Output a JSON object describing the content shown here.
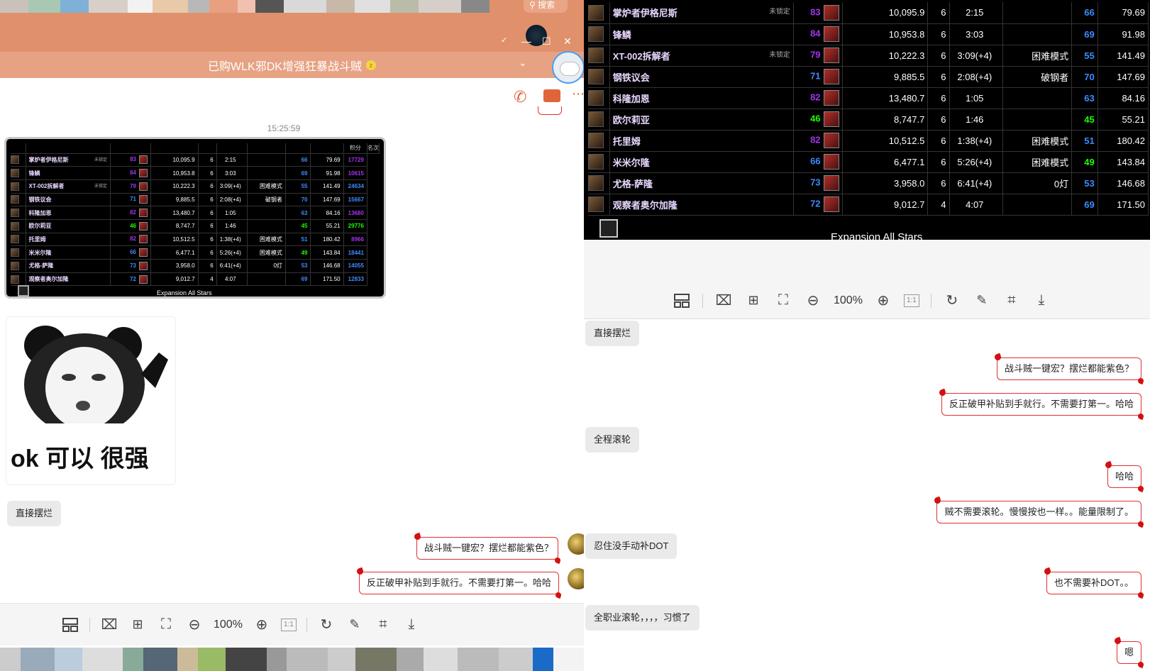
{
  "chat": {
    "title": "已购WLK邪DK增强狂暴战斗贼",
    "timestamp": "15:25:59",
    "search_placeholder": "搜索"
  },
  "scoreboard": {
    "header_small": [
      "",
      "",
      "",
      "",
      "",
      "",
      "",
      "积分",
      "名次"
    ],
    "footer": "Expansion All Stars",
    "rows": [
      {
        "name": "掌炉者伊格尼斯",
        "tag": "未锁定",
        "lvl": "83",
        "score": "10,095.9",
        "n": "6",
        "time": "2:15",
        "mode": "",
        "rank": "66",
        "pts": "79.69",
        "pos": "17729",
        "lvl_color": "pur",
        "rank_color": "blu",
        "pos_color": "pur"
      },
      {
        "name": "锋鳞",
        "tag": "",
        "lvl": "84",
        "score": "10,953.8",
        "n": "6",
        "time": "3:03",
        "mode": "",
        "rank": "69",
        "pts": "91.98",
        "pos": "10615",
        "lvl_color": "pur",
        "rank_color": "blu",
        "pos_color": "pur"
      },
      {
        "name": "XT-002拆解者",
        "tag": "未锁定",
        "lvl": "79",
        "score": "10,222.3",
        "n": "6",
        "time": "3:09(+4)",
        "mode": "困难模式",
        "rank": "55",
        "pts": "141.49",
        "pos": "24634",
        "lvl_color": "pur",
        "rank_color": "blu",
        "pos_color": "blu"
      },
      {
        "name": "钢铁议会",
        "tag": "",
        "lvl": "71",
        "score": "9,885.5",
        "n": "6",
        "time": "2:08(+4)",
        "mode": "破钢者",
        "rank": "70",
        "pts": "147.69",
        "pos": "15667",
        "lvl_color": "blu",
        "rank_color": "blu",
        "pos_color": "blu"
      },
      {
        "name": "科隆加恩",
        "tag": "",
        "lvl": "82",
        "score": "13,480.7",
        "n": "6",
        "time": "1:05",
        "mode": "",
        "rank": "63",
        "pts": "84.16",
        "pos": "13680",
        "lvl_color": "pur",
        "rank_color": "blu",
        "pos_color": "pur"
      },
      {
        "name": "欧尔莉亚",
        "tag": "",
        "lvl": "46",
        "score": "8,747.7",
        "n": "6",
        "time": "1:46",
        "mode": "",
        "rank": "45",
        "pts": "55.21",
        "pos": "29776",
        "lvl_color": "grn",
        "rank_color": "grn",
        "pos_color": "grn"
      },
      {
        "name": "托里姆",
        "tag": "",
        "lvl": "82",
        "score": "10,512.5",
        "n": "6",
        "time": "1:38(+4)",
        "mode": "困难模式",
        "rank": "51",
        "pts": "180.42",
        "pos": "8966",
        "lvl_color": "pur",
        "rank_color": "blu",
        "pos_color": "pur"
      },
      {
        "name": "米米尔隆",
        "tag": "",
        "lvl": "66",
        "score": "6,477.1",
        "n": "6",
        "time": "5:26(+4)",
        "mode": "困难模式",
        "rank": "49",
        "pts": "143.84",
        "pos": "18441",
        "lvl_color": "blu",
        "rank_color": "grn",
        "pos_color": "blu"
      },
      {
        "name": "尤格-萨隆",
        "tag": "",
        "lvl": "73",
        "score": "3,958.0",
        "n": "6",
        "time": "6:41(+4)",
        "mode": "0灯",
        "rank": "53",
        "pts": "146.68",
        "pos": "14055",
        "lvl_color": "blu",
        "rank_color": "blu",
        "pos_color": "blu"
      },
      {
        "name": "观察者奥尔加隆",
        "tag": "",
        "lvl": "72",
        "score": "9,012.7",
        "n": "4",
        "time": "4:07",
        "mode": "",
        "rank": "69",
        "pts": "171.50",
        "pos": "12833",
        "lvl_color": "blu",
        "rank_color": "blu",
        "pos_color": "blu"
      }
    ]
  },
  "sticker": {
    "text": "ok 可以 很强"
  },
  "left_messages": [
    {
      "side": "left",
      "text": "直接摆烂"
    },
    {
      "side": "right",
      "text": "战斗贼一键宏？摆烂都能紫色？"
    },
    {
      "side": "right",
      "text": "反正破甲补贴到手就行。不需要打第一。哈哈"
    }
  ],
  "right_messages": [
    {
      "side": "left",
      "text": "直接摆烂"
    },
    {
      "side": "right",
      "text": "战斗贼一键宏？摆烂都能紫色？"
    },
    {
      "side": "right",
      "text": "反正破甲补贴到手就行。不需要打第一。哈哈"
    },
    {
      "side": "left",
      "text": "全程滚轮"
    },
    {
      "side": "right",
      "text": "哈哈"
    },
    {
      "side": "right",
      "text": "贼不需要滚轮。慢慢按也一样。。能量限制了。"
    },
    {
      "side": "left",
      "text": "忍住没手动补DOT"
    },
    {
      "side": "right",
      "text": "也不需要补DOT。。"
    },
    {
      "side": "left",
      "text": "全职业滚轮，，，，习惯了"
    },
    {
      "side": "right",
      "text": "嗯"
    }
  ],
  "viewer_toolbar": {
    "zoom": "100%",
    "ratio_label": "1:1"
  },
  "colors": {
    "orange": "#e0916b",
    "title_orange": "#e7a283",
    "accent_red": "#e03030"
  }
}
